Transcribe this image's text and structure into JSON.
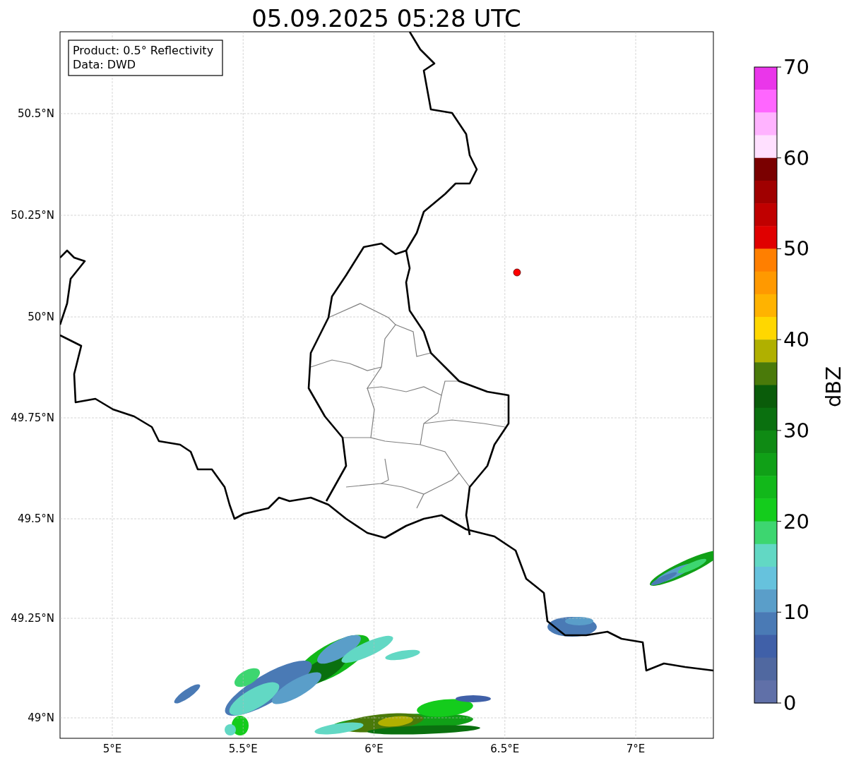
{
  "title": "05.09.2025 05:28 UTC",
  "info_box": [
    "Product: 0.5° Reflectivity",
    "Data: DWD"
  ],
  "map": {
    "lon_ticks": [
      "5°E",
      "5.5°E",
      "6°E",
      "6.5°E",
      "7°E"
    ],
    "lat_ticks": [
      "50.5°N",
      "50.25°N",
      "50°N",
      "49.75°N",
      "49.5°N",
      "49.25°N",
      "49°N"
    ]
  },
  "colorbar": {
    "label": "dBZ",
    "ticks": [
      "70",
      "60",
      "50",
      "40",
      "30",
      "20",
      "10",
      "0"
    ],
    "bins": [
      {
        "color": "#ea36ea"
      },
      {
        "color": "#ff66ff"
      },
      {
        "color": "#ffb3ff"
      },
      {
        "color": "#ffe0ff"
      },
      {
        "color": "#7a0000"
      },
      {
        "color": "#a00000"
      },
      {
        "color": "#c00000"
      },
      {
        "color": "#e00000"
      },
      {
        "color": "#ff7f00"
      },
      {
        "color": "#ff9900"
      },
      {
        "color": "#ffb300"
      },
      {
        "color": "#ffd700"
      },
      {
        "color": "#b0b000"
      },
      {
        "color": "#4a7a0a"
      },
      {
        "color": "#0a5c0a"
      },
      {
        "color": "#0a700f"
      },
      {
        "color": "#0f8a14"
      },
      {
        "color": "#10a017"
      },
      {
        "color": "#12b81a"
      },
      {
        "color": "#14cc1c"
      },
      {
        "color": "#3dd670"
      },
      {
        "color": "#62d8c4"
      },
      {
        "color": "#66c2dd"
      },
      {
        "color": "#5a9ec9"
      },
      {
        "color": "#4a7ab5"
      },
      {
        "color": "#4060a8"
      },
      {
        "color": "#5068a0"
      },
      {
        "color": "#6070a8"
      }
    ]
  }
}
